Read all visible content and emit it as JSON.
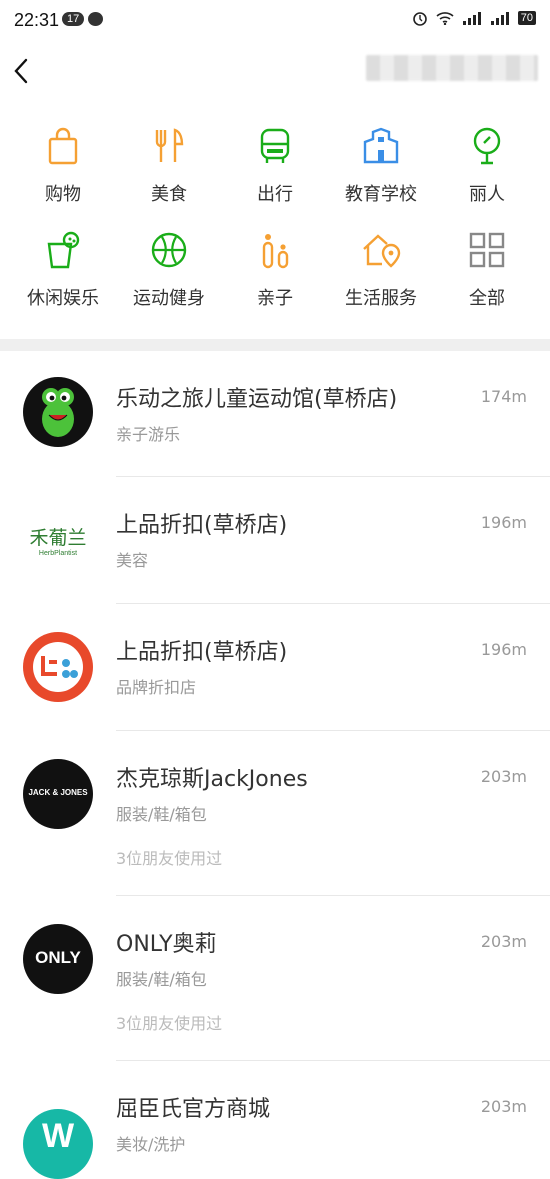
{
  "status_bar": {
    "time": "22:31",
    "notification_count": "17",
    "battery": "70"
  },
  "colors": {
    "orange": "#f5a033",
    "green": "#1aad19",
    "blue": "#3a8ee6",
    "gray": "#888888"
  },
  "categories": [
    {
      "label": "购物",
      "icon": "shopping-bag-icon",
      "color": "orange"
    },
    {
      "label": "美食",
      "icon": "fork-knife-icon",
      "color": "orange"
    },
    {
      "label": "出行",
      "icon": "bus-icon",
      "color": "green"
    },
    {
      "label": "教育学校",
      "icon": "school-building-icon",
      "color": "blue"
    },
    {
      "label": "丽人",
      "icon": "mirror-icon",
      "color": "green"
    },
    {
      "label": "休闲娱乐",
      "icon": "drink-cup-icon",
      "color": "green"
    },
    {
      "label": "运动健身",
      "icon": "ball-icon",
      "color": "green"
    },
    {
      "label": "亲子",
      "icon": "parent-child-icon",
      "color": "orange"
    },
    {
      "label": "生活服务",
      "icon": "house-pin-icon",
      "color": "orange"
    },
    {
      "label": "全部",
      "icon": "grid-icon",
      "color": "gray"
    }
  ],
  "stores": [
    {
      "name": "乐动之旅儿童运动馆(草桥店)",
      "category": "亲子游乐",
      "distance": "174m",
      "friends": ""
    },
    {
      "name": "上品折扣(草桥店)",
      "category": "美容",
      "distance": "196m",
      "friends": "",
      "logo_text": "禾葡兰",
      "logo_sub": "HerbPlantist"
    },
    {
      "name": "上品折扣(草桥店)",
      "category": "品牌折扣店",
      "distance": "196m",
      "friends": ""
    },
    {
      "name": "杰克琼斯JackJones",
      "category": "服装/鞋/箱包",
      "distance": "203m",
      "friends": "3位朋友使用过",
      "logo_text": "JACK & JONES"
    },
    {
      "name": "ONLY奥莉",
      "category": "服装/鞋/箱包",
      "distance": "203m",
      "friends": "3位朋友使用过",
      "logo_text": "ONLY"
    },
    {
      "name": "屈臣氏官方商城",
      "category": "美妆/洗护",
      "distance": "203m",
      "friends": "",
      "logo_text": "W"
    }
  ]
}
